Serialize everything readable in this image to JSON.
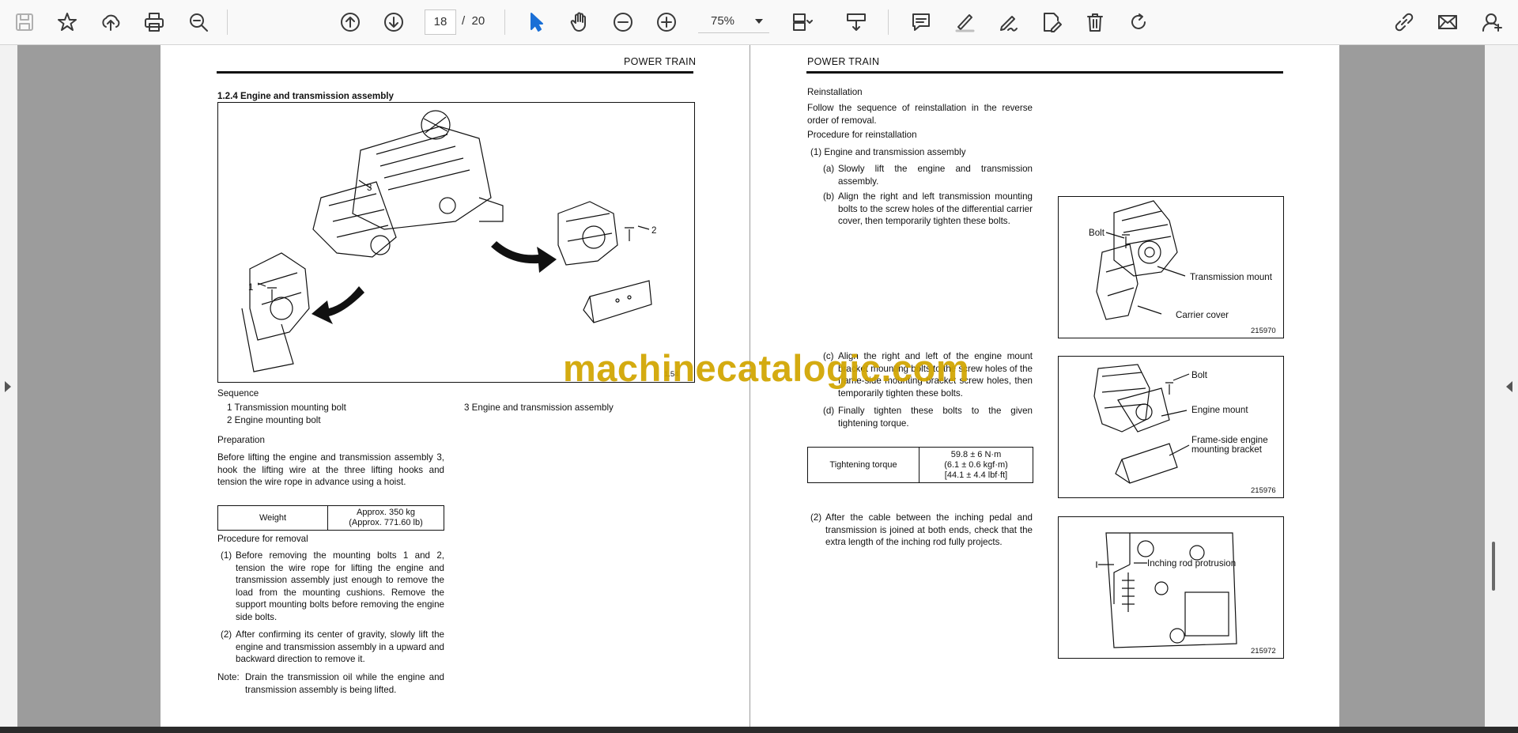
{
  "toolbar": {
    "current_page": "18",
    "page_separator": "/",
    "total_pages": "20",
    "zoom": "75%"
  },
  "left_page": {
    "header": "POWER TRAIN",
    "section_title": "1.2.4   Engine and transmission assembly",
    "figure_labels": [
      "3",
      "1",
      "2"
    ],
    "figure_no": "1.54",
    "sequence_title": "Sequence",
    "sequence_items": [
      "1  Transmission mounting bolt",
      "2  Engine mounting bolt",
      "3  Engine and transmission assembly"
    ],
    "preparation_title": "Preparation",
    "preparation_text": "Before lifting the engine and transmission assembly 3, hook the lifting wire at the three lifting hooks and tension the wire rope in advance using a hoist.",
    "weight_table": {
      "label": "Weight",
      "value_line1": "Approx. 350 kg",
      "value_line2": "(Approx. 771.60 lb)"
    },
    "removal_title": "Procedure for removal",
    "removal_steps": [
      {
        "num": "(1)",
        "text": "Before removing the mounting bolts 1 and 2, tension the wire rope for lifting the engine and transmission assembly just enough to remove the load from the mounting cushions. Remove the support mounting bolts before removing the engine side bolts."
      },
      {
        "num": "(2)",
        "text": "After confirming its center of gravity, slowly lift the engine and transmission assembly in a upward and backward direction to remove it."
      }
    ],
    "note_label": "Note:",
    "note_text": "Drain the transmission oil while the engine and transmission assembly is being lifted."
  },
  "right_page": {
    "header": "POWER TRAIN",
    "reinstall_title": "Reinstallation",
    "reinstall_text": "Follow the sequence of reinstallation in the reverse order of removal.",
    "procedure_title": "Procedure for reinstallation",
    "step1": "(1)  Engine and transmission assembly",
    "step1a_num": "(a)",
    "step1a": "Slowly lift the engine and transmission assembly.",
    "step1b_num": "(b)",
    "step1b": "Align the right and left transmission mounting bolts to the screw holes of the differential carrier cover, then temporarily tighten these bolts.",
    "step1c_num": "(c)",
    "step1c": "Align the right and left of the engine mount bracket mounting bolts to the screw holes of the frame-side mounting bracket screw holes, then temporarily tighten these bolts.",
    "step1d_num": "(d)",
    "step1d": "Finally tighten these bolts to the given tightening torque.",
    "torque_table": {
      "label": "Tightening torque",
      "value_line1": "59.8 ± 6 N·m",
      "value_line2": "(6.1 ± 0.6 kgf·m)",
      "value_line3": "[44.1 ± 4.4 lbf·ft]"
    },
    "step2_num": "(2)",
    "step2": "After the cable between the inching pedal and transmission is joined at both ends, check that the extra length of the inching rod fully projects.",
    "fig1": {
      "label_bolt": "Bolt",
      "label_mount": "Transmission mount",
      "label_cover": "Carrier cover",
      "no": "215970"
    },
    "fig2": {
      "label_bolt": "Bolt",
      "label_mount": "Engine mount",
      "label_bracket1": "Frame-side engine",
      "label_bracket2": "mounting bracket",
      "no": "215976"
    },
    "fig3": {
      "label_rod": "Inching rod protrusion",
      "no": "215972"
    }
  },
  "watermark": "machinecatalogic.com",
  "icons": [
    "save-icon",
    "bookmark-star-icon",
    "upload-cloud-icon",
    "print-icon",
    "zoom-search-icon",
    "page-up-icon",
    "page-down-icon",
    "select-cursor-icon",
    "hand-pan-icon",
    "zoom-out-icon",
    "zoom-in-icon",
    "page-view-icon",
    "download-icon",
    "comment-icon",
    "highlight-icon",
    "sign-icon",
    "edit-pdf-icon",
    "delete-icon",
    "redo-icon",
    "link-edit-icon",
    "mail-icon",
    "add-user-icon"
  ],
  "colors": {
    "active_tool": "#1a6fd6",
    "watermark": "#d1a500"
  }
}
